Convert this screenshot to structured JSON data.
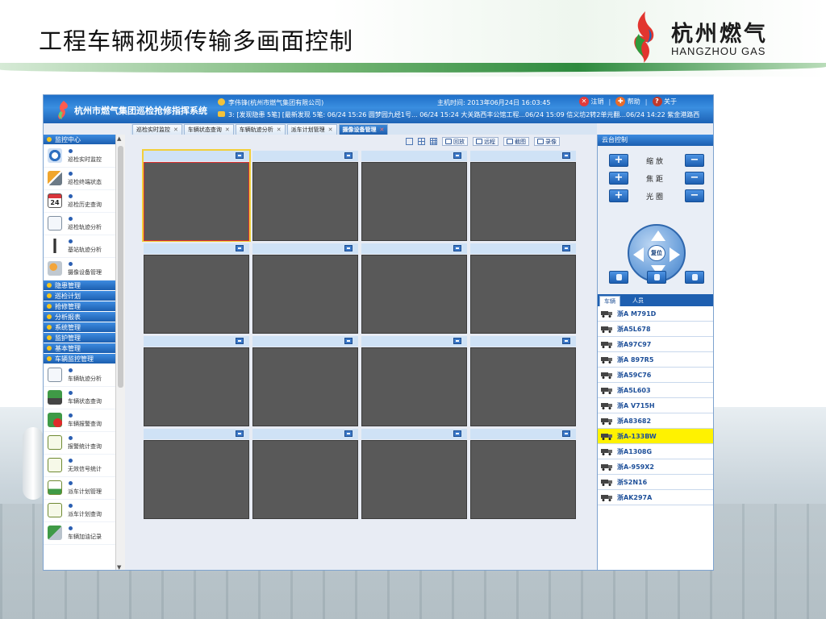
{
  "slide": {
    "title": "工程车辆视频传输多画面控制",
    "logo_cn": "杭州燃气",
    "logo_en": "HANGZHOU GAS"
  },
  "app": {
    "title": "杭州市燃气集团巡检抢修指挥系统",
    "user": "李伟锋(杭州市燃气集团有限公司)",
    "message": "3: [发现隐患 5笔] [最新发现 5笔: 06/24 15:26 圆梦园九经1号... 06/24 15:24 大关路西丰公馆工程...06/24 15:09 信义坊2转2单元翻...06/24 14:22 紫金港路西",
    "host_time": "主机时间: 2013年06月24日 16:03:45",
    "links": [
      {
        "label": "注销",
        "icon": "logout-icon",
        "color": "#e23b3b"
      },
      {
        "label": "帮助",
        "icon": "help-icon",
        "color": "#e96c2a"
      },
      {
        "label": "关于",
        "icon": "about-icon",
        "color": "#c0392b"
      }
    ]
  },
  "tabs": [
    {
      "label": "巡检实时监控",
      "active": false
    },
    {
      "label": "车辆状态查询",
      "active": false
    },
    {
      "label": "车辆轨迹分析",
      "active": false
    },
    {
      "label": "派车计划管理",
      "active": false
    },
    {
      "label": "摄像设备管理",
      "active": true
    }
  ],
  "sidebar": {
    "monitor_head": "监控中心",
    "monitor_items": [
      {
        "label": "巡检实时监控",
        "icon": "monitor-icon"
      },
      {
        "label": "巡检终端状态",
        "icon": "tools-icon"
      },
      {
        "label": "巡检历史查询",
        "icon": "calendar-icon"
      },
      {
        "label": "巡检轨迹分析",
        "icon": "track-icon"
      },
      {
        "label": "基站轨迹分析",
        "icon": "antenna-icon"
      },
      {
        "label": "摄像设备管理",
        "icon": "camera-icon"
      }
    ],
    "groups": [
      "隐患管理",
      "巡检计划",
      "抢修管理",
      "分析报表",
      "系统管理",
      "监护管理",
      "基本管理",
      "车辆监控管理"
    ],
    "vehicle_items": [
      {
        "label": "车辆轨迹分析",
        "icon": "track-icon"
      },
      {
        "label": "车辆状态查询",
        "icon": "truck-icon"
      },
      {
        "label": "车辆报警查询",
        "icon": "alarm-truck-icon"
      },
      {
        "label": "报警统计查询",
        "icon": "report-icon"
      },
      {
        "label": "无效信号统计",
        "icon": "report-icon"
      },
      {
        "label": "派车计划管理",
        "icon": "plan-icon"
      },
      {
        "label": "派车计划查询",
        "icon": "report-icon"
      },
      {
        "label": "车辆加油记录",
        "icon": "fuel-icon"
      }
    ]
  },
  "toolbar": [
    {
      "label": "回放"
    },
    {
      "label": "远程"
    },
    {
      "label": "截图"
    },
    {
      "label": "录像"
    }
  ],
  "ptz": {
    "head": "云台控制",
    "rows": [
      "缩放",
      "焦距",
      "光圈"
    ],
    "center": "复位"
  },
  "vehicle_tabs": [
    "车辆",
    "人员"
  ],
  "vehicles": [
    {
      "plate": "浙A M791D",
      "highlight": false
    },
    {
      "plate": "浙A5L678",
      "highlight": false
    },
    {
      "plate": "浙A97C97",
      "highlight": false
    },
    {
      "plate": "浙A 897R5",
      "highlight": false
    },
    {
      "plate": "浙A59C76",
      "highlight": false
    },
    {
      "plate": "浙A5L603",
      "highlight": false
    },
    {
      "plate": "浙A V715H",
      "highlight": false
    },
    {
      "plate": "浙A83682",
      "highlight": false
    },
    {
      "plate": "浙A-133BW",
      "highlight": true
    },
    {
      "plate": "浙A1308G",
      "highlight": false
    },
    {
      "plate": "浙A-959X2",
      "highlight": false
    },
    {
      "plate": "浙S2N16",
      "highlight": false
    },
    {
      "plate": "浙AK297A",
      "highlight": false
    }
  ],
  "colors": {
    "header_blue": "#1f6fc8",
    "video_cell": "#595959",
    "selected_outline": "#f2cf3a",
    "highlight_row": "#fff200"
  }
}
